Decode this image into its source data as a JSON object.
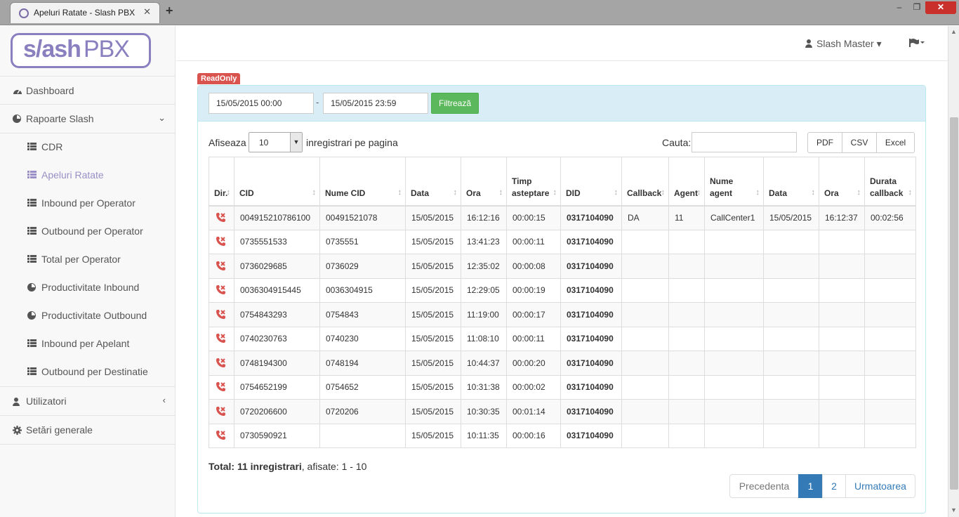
{
  "browser": {
    "tab_title": "Apeluri Ratate - Slash PBX",
    "close_glyph": "✕",
    "new_tab_glyph": "+",
    "window_controls": {
      "minimize": "–",
      "maximize": "❐",
      "close": "✕"
    }
  },
  "logo": {
    "slash": "s/ash",
    "pbx": "PBX"
  },
  "sidebar": {
    "items": [
      {
        "label": "Dashboard",
        "icon": "dashboard-icon"
      },
      {
        "label": "Rapoarte Slash",
        "icon": "pie-chart-icon",
        "caret": "⌄"
      },
      {
        "label": "Utilizatori",
        "icon": "user-icon",
        "caret": "‹"
      },
      {
        "label": "Setări generale",
        "icon": "gear-icon"
      }
    ],
    "sub_items": [
      {
        "label": "CDR",
        "icon": "list-icon"
      },
      {
        "label": "Apeluri Ratate",
        "icon": "list-icon"
      },
      {
        "label": "Inbound per Operator",
        "icon": "list-icon"
      },
      {
        "label": "Outbound per Operator",
        "icon": "list-icon"
      },
      {
        "label": "Total per Operator",
        "icon": "list-icon"
      },
      {
        "label": "Productivitate Inbound",
        "icon": "pie-chart-icon"
      },
      {
        "label": "Productivitate Outbound",
        "icon": "pie-chart-icon"
      },
      {
        "label": "Inbound per Apelant",
        "icon": "list-icon"
      },
      {
        "label": "Outbound per Destinatie",
        "icon": "list-icon"
      }
    ]
  },
  "header": {
    "user": "Slash Master",
    "user_caret": "▾",
    "flag_icon": "flag-icon"
  },
  "badge": "ReadOnly",
  "filter": {
    "from": "15/05/2015 00:00",
    "separator": "-",
    "to": "15/05/2015 23:59",
    "button": "Filtrează"
  },
  "controls": {
    "show_label": "Afiseaza",
    "page_length": "10",
    "per_page_label": "inregistrari pe pagina",
    "search_label": "Cauta:",
    "search_value": "",
    "exports": [
      "PDF",
      "CSV",
      "Excel"
    ]
  },
  "table": {
    "columns": [
      "Dir.",
      "CID",
      "Nume CID",
      "Data",
      "Ora",
      "Timp asteptare",
      "DID",
      "Callback",
      "Agent",
      "Nume agent",
      "Data",
      "Ora",
      "Durata callback"
    ],
    "rows": [
      [
        "004915210786100",
        "00491521078",
        "15/05/2015",
        "16:12:16",
        "00:00:15",
        "0317104090",
        "DA",
        "11",
        "CallCenter1",
        "15/05/2015",
        "16:12:37",
        "00:02:56"
      ],
      [
        "0735551533",
        "0735551",
        "15/05/2015",
        "13:41:23",
        "00:00:11",
        "0317104090",
        "",
        "",
        "",
        "",
        "",
        ""
      ],
      [
        "0736029685",
        "0736029",
        "15/05/2015",
        "12:35:02",
        "00:00:08",
        "0317104090",
        "",
        "",
        "",
        "",
        "",
        ""
      ],
      [
        "0036304915445",
        "0036304915",
        "15/05/2015",
        "12:29:05",
        "00:00:19",
        "0317104090",
        "",
        "",
        "",
        "",
        "",
        ""
      ],
      [
        "0754843293",
        "0754843",
        "15/05/2015",
        "11:19:00",
        "00:00:17",
        "0317104090",
        "",
        "",
        "",
        "",
        "",
        ""
      ],
      [
        "0740230763",
        "0740230",
        "15/05/2015",
        "11:08:10",
        "00:00:11",
        "0317104090",
        "",
        "",
        "",
        "",
        "",
        ""
      ],
      [
        "0748194300",
        "0748194",
        "15/05/2015",
        "10:44:37",
        "00:00:20",
        "0317104090",
        "",
        "",
        "",
        "",
        "",
        ""
      ],
      [
        "0754652199",
        "0754652",
        "15/05/2015",
        "10:31:38",
        "00:00:02",
        "0317104090",
        "",
        "",
        "",
        "",
        "",
        ""
      ],
      [
        "0720206600",
        "0720206",
        "15/05/2015",
        "10:30:35",
        "00:01:14",
        "0317104090",
        "",
        "",
        "",
        "",
        "",
        ""
      ],
      [
        "0730590921",
        "",
        "15/05/2015",
        "10:11:35",
        "00:00:16",
        "0317104090",
        "",
        "",
        "",
        "",
        "",
        ""
      ]
    ],
    "row_icon": "missed-call-icon",
    "row_icon_color": "#d9534f",
    "sort_glyph": "↕"
  },
  "footer": {
    "total_bold": "Total: 11 inregistrari",
    "total_rest": ", afisate: 1 - 10",
    "pagination": {
      "prev": "Precedenta",
      "pages": [
        "1",
        "2"
      ],
      "next": "Urmatoarea"
    }
  },
  "colors": {
    "accent": "#8a7fbf",
    "primary": "#337ab7",
    "success": "#5cb85c",
    "danger": "#d9534f",
    "panel": "#d9edf7"
  }
}
